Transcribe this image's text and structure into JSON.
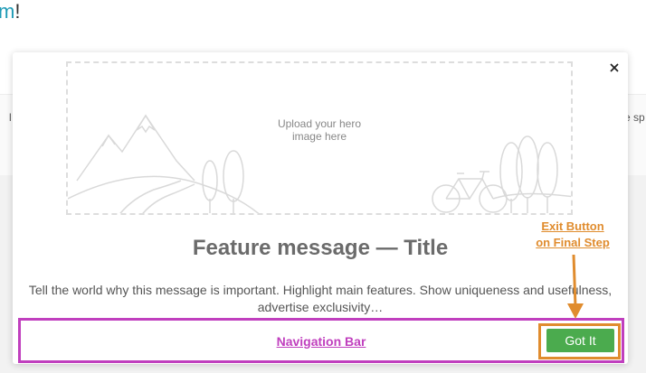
{
  "background": {
    "title_suffix": "m",
    "title_punct": "!",
    "left_fragment": "l",
    "right_fragment": "e sp"
  },
  "modal": {
    "close_icon": "close-icon",
    "hero": {
      "upload_line1": "Upload your hero",
      "upload_line2": "image here",
      "illustration": "landscape-mountains-trees-bicycle"
    },
    "title": "Feature message — Title",
    "body": "Tell the world why this message is important. Highlight main features. Show uniqueness and usefulness, advertise exclusivity…"
  },
  "navigation": {
    "annotation_label": "Navigation Bar",
    "got_it_label": "Got It"
  },
  "exit_annotation": {
    "line1": "Exit Button",
    "line2": "on Final Step"
  },
  "colors": {
    "accent": "#1f9bb6",
    "nav_annotation": "#c03fbe",
    "exit_annotation": "#e08c2e",
    "button_green": "#4bab4e",
    "title_gray": "#6b6b6b"
  }
}
